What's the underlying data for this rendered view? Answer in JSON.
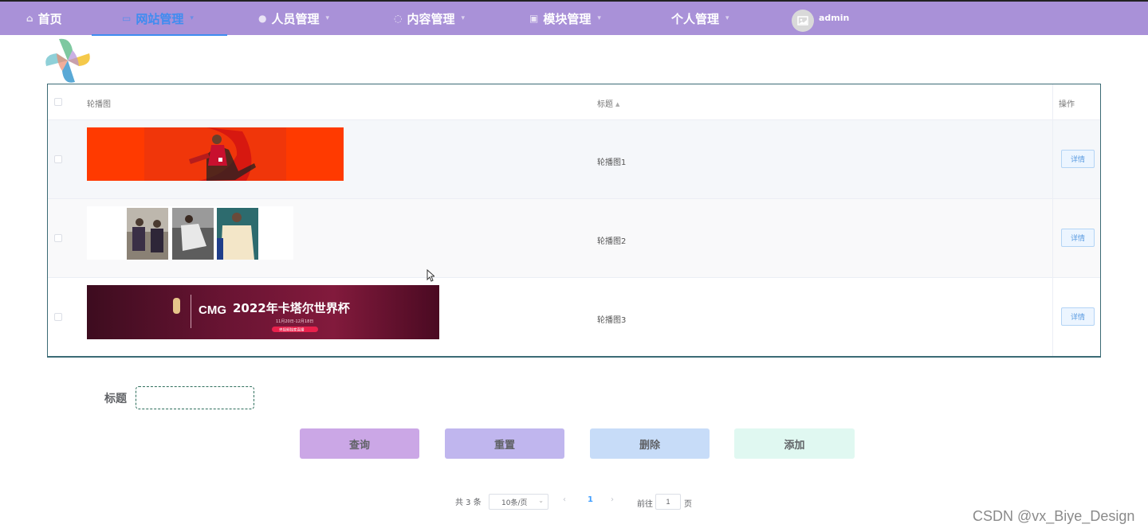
{
  "nav": {
    "items": [
      {
        "label": "首页",
        "icon": "home-icon"
      },
      {
        "label": "网站管理",
        "icon": "monitor-icon"
      },
      {
        "label": "人员管理",
        "icon": "user-icon"
      },
      {
        "label": "内容管理",
        "icon": "content-icon"
      },
      {
        "label": "模块管理",
        "icon": "module-icon"
      },
      {
        "label": "个人管理",
        "icon": ""
      }
    ],
    "username": "admin",
    "active_color": "#3f8cf0",
    "bar_color": "#a991d8"
  },
  "table": {
    "headers": {
      "image": "轮播图",
      "title": "标题",
      "action": "操作"
    },
    "rows": [
      {
        "title": "轮播图1",
        "action": "详情"
      },
      {
        "title": "轮播图2",
        "action": "详情"
      },
      {
        "title": "轮播图3",
        "action": "详情"
      }
    ],
    "banner3": {
      "brand": "CMG",
      "headline": "2022年卡塔尔世界杯",
      "date": "11月20日-12月18日",
      "tag": "央视频独家直播"
    }
  },
  "search": {
    "label": "标题",
    "value": ""
  },
  "buttons": {
    "query": "查询",
    "reset": "重置",
    "delete": "删除",
    "add": "添加"
  },
  "pagination": {
    "total": "共 3 条",
    "page_size": "10条/页",
    "prev": "‹",
    "current_page": "1",
    "next": "›",
    "goto": "前往",
    "goto_value": "1",
    "unit": "页"
  },
  "watermark": "CSDN @vx_Biye_Design"
}
